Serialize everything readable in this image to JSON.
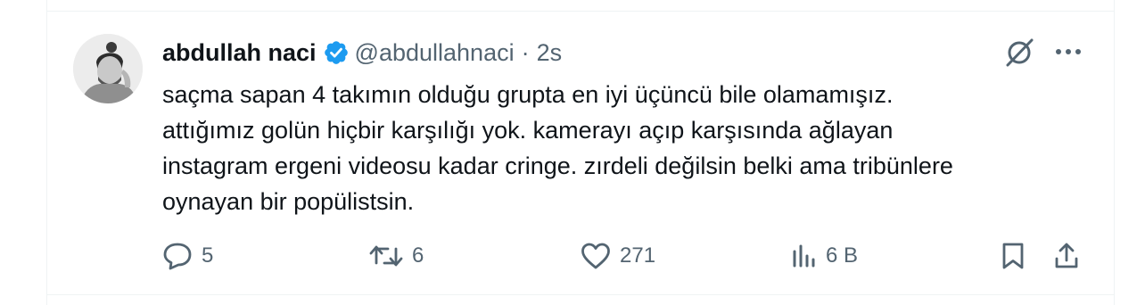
{
  "tweet": {
    "author_name": "abdullah naci",
    "handle": "@abdullahnaci",
    "separator": "·",
    "time": "2s",
    "text_lines": [
      "saçma sapan 4 takımın olduğu grupta en iyi üçüncü bile olamamışız.",
      "attığımız golün hiçbir karşılığı yok. kamerayı açıp karşısında ağlayan",
      "instagram ergeni videosu kadar cringe. zırdeli değilsin belki ama tribünlere",
      "oynayan bir popülistsin."
    ],
    "verified_color": "#1d9bf0"
  },
  "actions": {
    "replies": "5",
    "reposts": "6",
    "likes": "271",
    "views": "6 B"
  },
  "icons": {
    "reply": "speech-bubble-icon",
    "repost": "repost-arrows-icon",
    "like": "heart-icon",
    "views": "bar-chart-icon",
    "bookmark": "bookmark-icon",
    "share": "share-upload-icon",
    "grok": "grok-slash-icon",
    "more": "ellipsis-icon"
  },
  "colors": {
    "text": "#0f1419",
    "muted": "#536471",
    "border": "#eff3f4"
  }
}
